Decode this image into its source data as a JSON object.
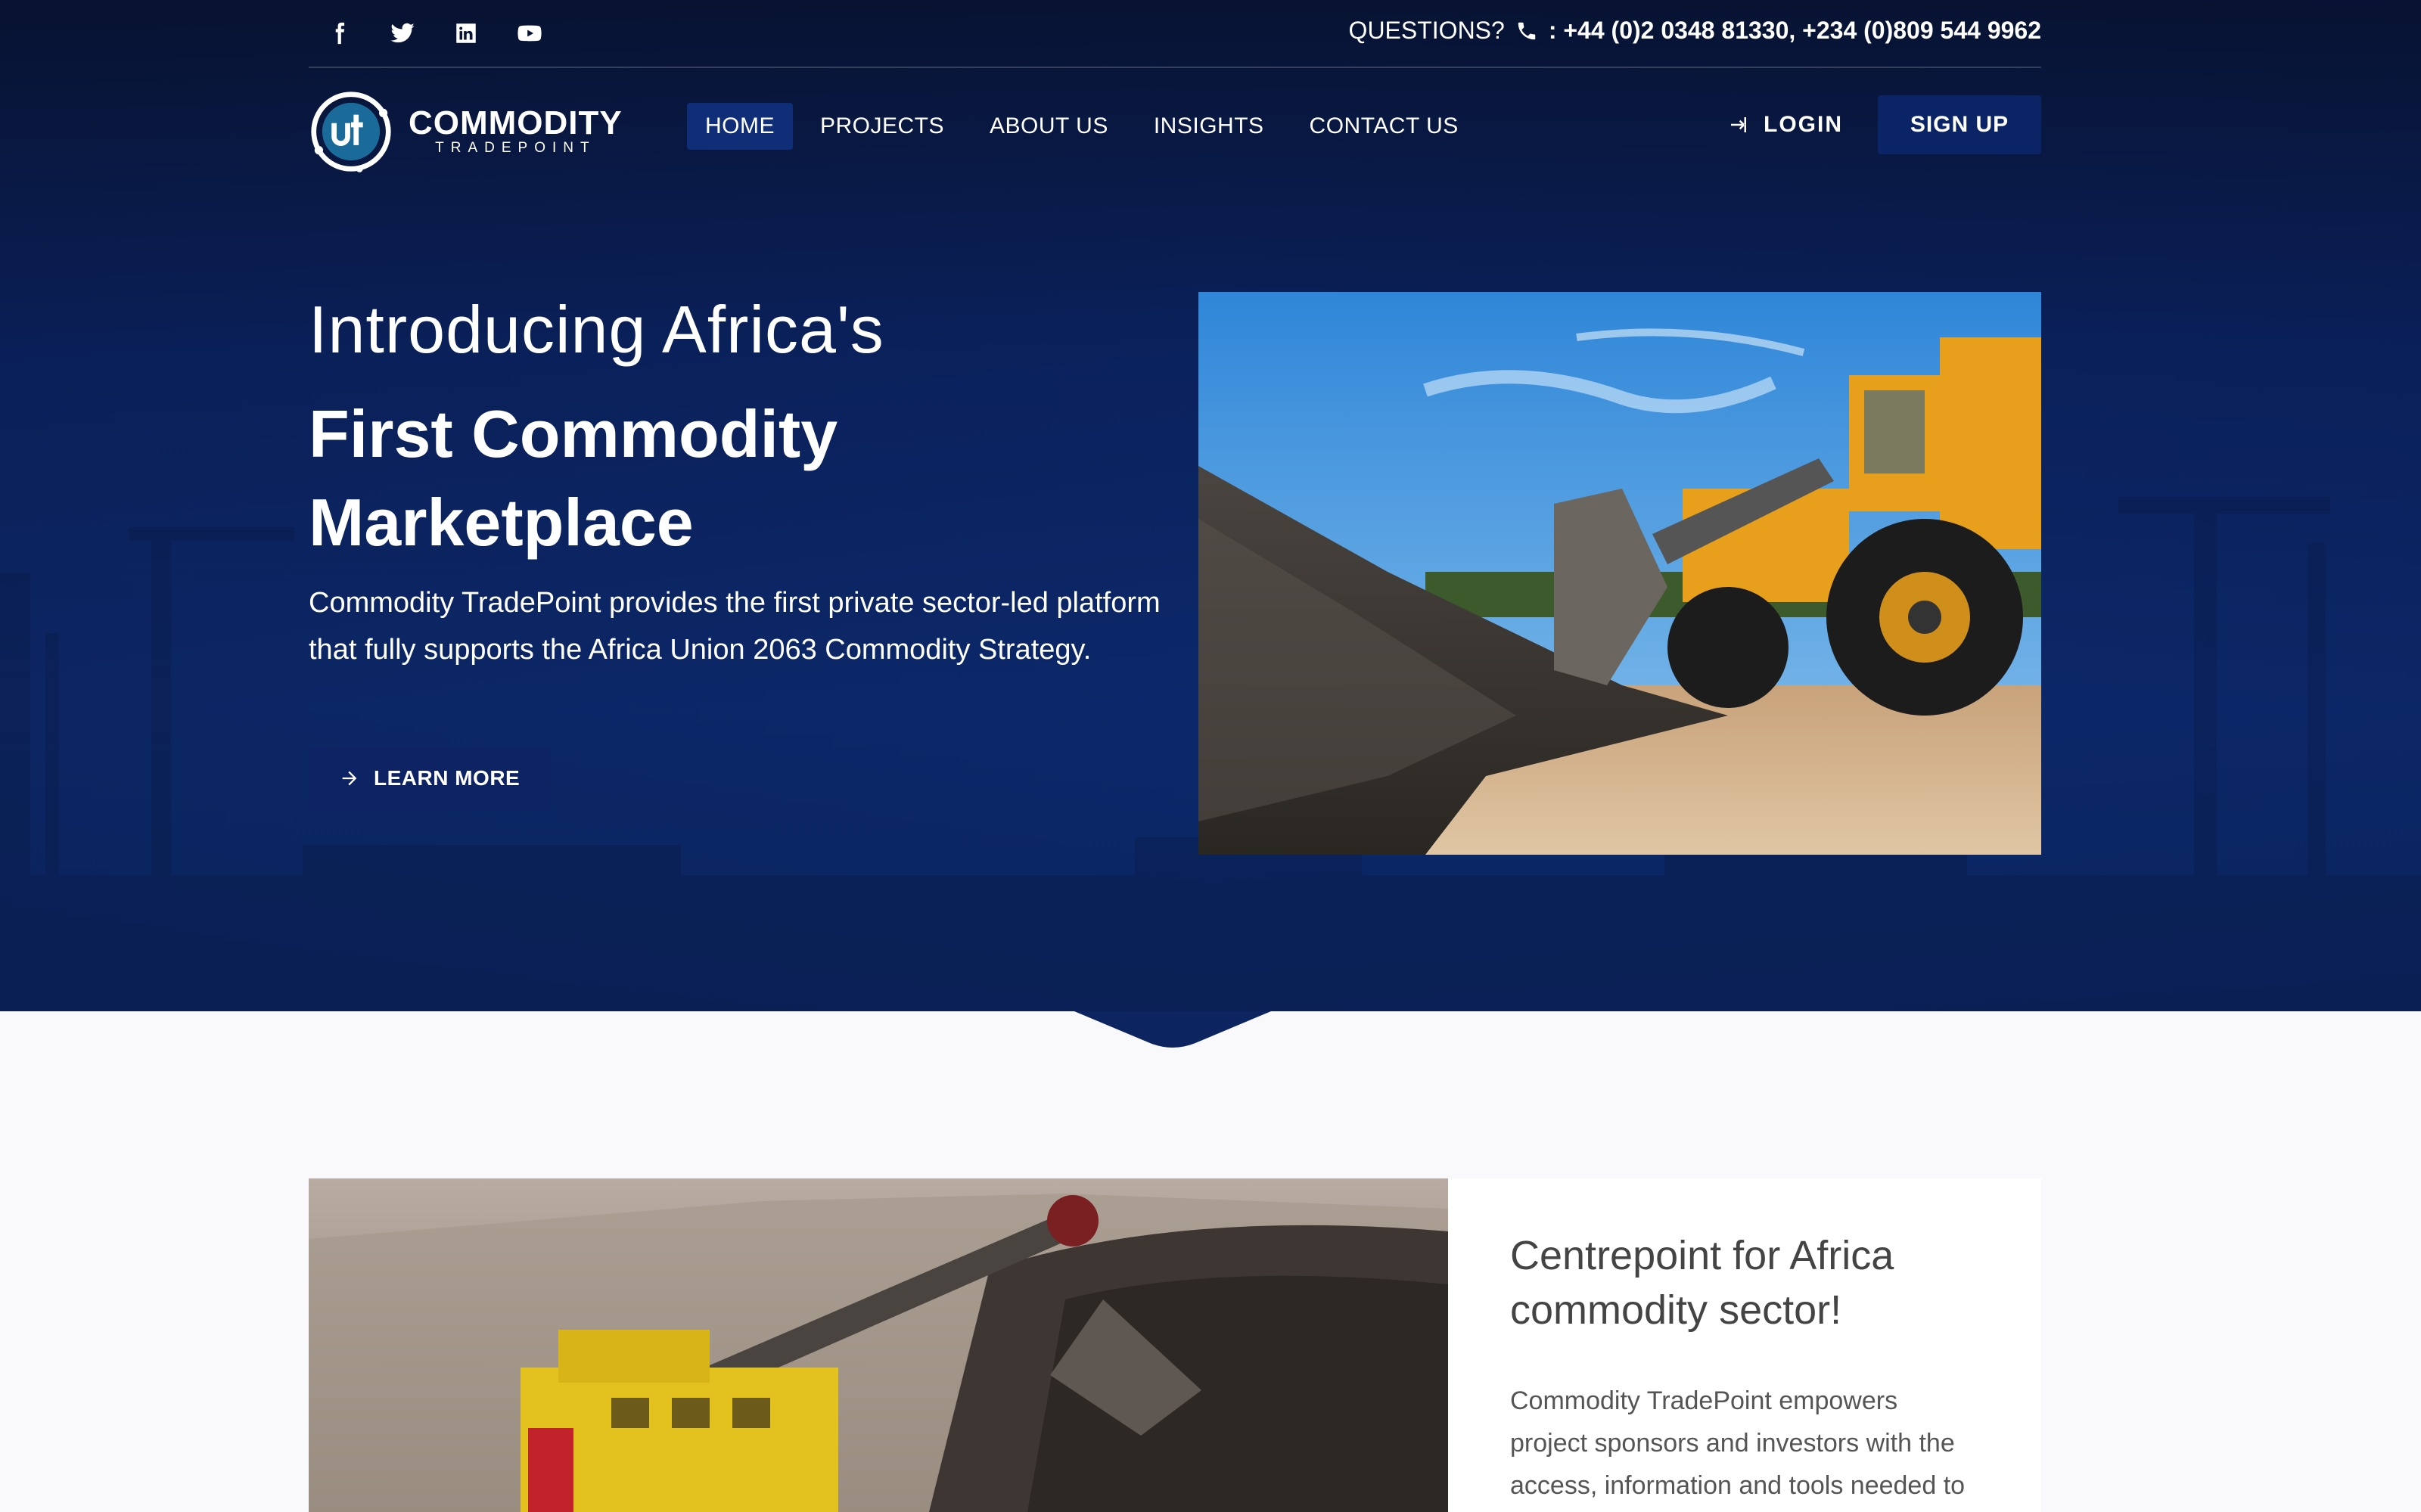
{
  "topbar": {
    "social": [
      "facebook-icon",
      "twitter-icon",
      "linkedin-icon",
      "youtube-icon"
    ],
    "questions_label": "QUESTIONS?",
    "phone_text": ": +44 (0)2 0348 81330, +234 (0)809 544 9962"
  },
  "brand": {
    "name": "COMMODITY",
    "tagline": "TRADEPOINT"
  },
  "nav": {
    "items": [
      {
        "label": "HOME",
        "active": true
      },
      {
        "label": "PROJECTS",
        "active": false
      },
      {
        "label": "ABOUT US",
        "active": false
      },
      {
        "label": "INSIGHTS",
        "active": false
      },
      {
        "label": "CONTACT US",
        "active": false
      }
    ],
    "login_label": "LOGIN",
    "signup_label": "SIGN UP"
  },
  "hero": {
    "intro": "Introducing Africa's",
    "headline": "First Commodity Marketplace",
    "lead": "Commodity TradePoint provides the first private sector-led platform that fully supports the Africa Union 2063 Commodity Strategy.",
    "cta_label": "LEARN MORE"
  },
  "feature": {
    "title": "Centrepoint for Africa commodity sector!",
    "body": "Commodity TradePoint empowers project sponsors and investors with the access, information and tools needed to"
  },
  "colors": {
    "hero_bg": "#0e2c72",
    "nav_active": "#102d78",
    "signup_bg": "#0b2466",
    "cta_bg": "#0d2363"
  }
}
